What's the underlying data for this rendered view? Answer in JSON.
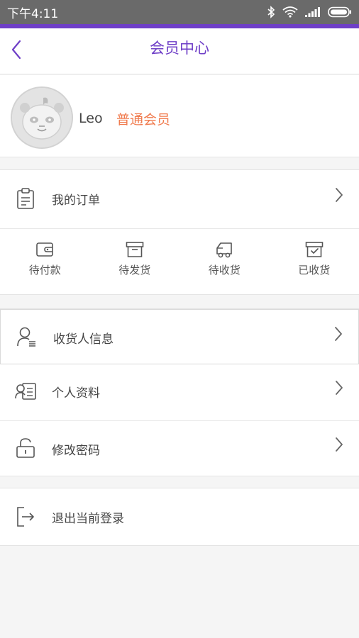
{
  "status_bar": {
    "time": "下午4:11",
    "icons": [
      "bluetooth-icon",
      "wifi-icon",
      "signal-icon",
      "battery-icon"
    ]
  },
  "header": {
    "title": "会员中心",
    "back_icon": "chevron-left-icon"
  },
  "profile": {
    "name": "Leo",
    "level": "普通会员",
    "avatar_icon": "panda-avatar"
  },
  "orders": {
    "label": "我的订单",
    "icon": "clipboard-icon",
    "statuses": [
      {
        "label": "待付款",
        "icon": "wallet-icon"
      },
      {
        "label": "待发货",
        "icon": "box-icon"
      },
      {
        "label": "待收货",
        "icon": "truck-icon"
      },
      {
        "label": "已收货",
        "icon": "received-box-icon"
      }
    ]
  },
  "settings": [
    {
      "label": "收货人信息",
      "icon": "user-list-icon"
    },
    {
      "label": "个人资料",
      "icon": "id-card-icon"
    },
    {
      "label": "修改密码",
      "icon": "lock-icon"
    }
  ],
  "logout": {
    "label": "退出当前登录",
    "icon": "logout-icon"
  },
  "colors": {
    "accent": "#6f3fc7",
    "member_level": "#f07b4e",
    "status_bar": "#6a6a6a",
    "background": "#f5f5f5"
  }
}
